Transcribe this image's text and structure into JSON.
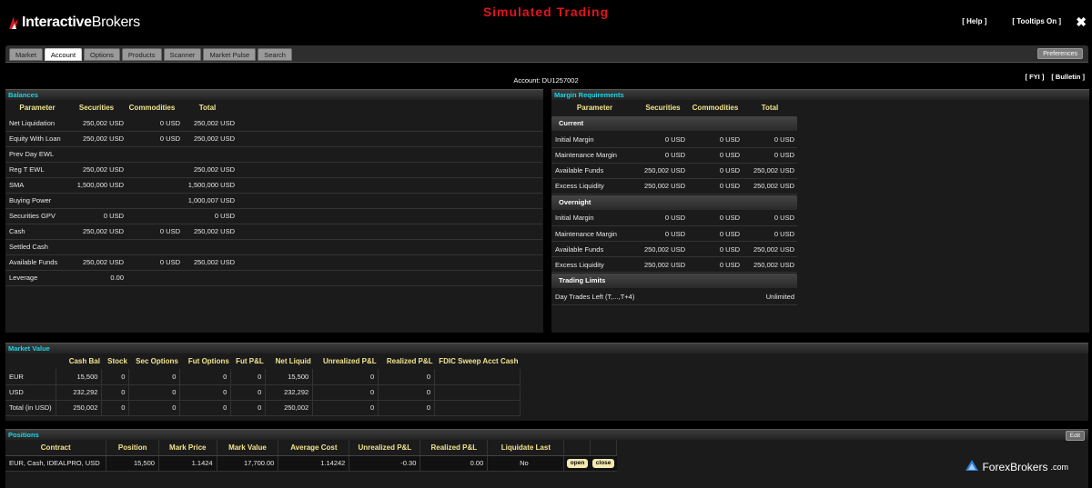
{
  "header": {
    "logo_bold": "Interactive",
    "logo_rest": "Brokers",
    "title": "Simulated Trading",
    "help": "[ Help ]",
    "tooltips": "[ Tooltips On ]",
    "close": "✖"
  },
  "tabs": [
    "Market",
    "Account",
    "Options",
    "Products",
    "Scanner",
    "Market Pulse",
    "Search"
  ],
  "preferences": "Preferences",
  "account_line": "Account: DU1257002",
  "fyi": "[ FYI ]",
  "bulletin": "[ Bulletin ]",
  "balances": {
    "title": "Balances",
    "columns": [
      "Parameter",
      "Securities",
      "Commodities",
      "Total"
    ],
    "rows": [
      [
        "Net Liquidation",
        "250,002 USD",
        "0 USD",
        "250,002 USD"
      ],
      [
        "Equity With Loan",
        "250,002 USD",
        "0 USD",
        "250,002 USD"
      ],
      [
        "Prev Day EWL",
        "",
        "",
        ""
      ],
      [
        "Reg T EWL",
        "250,002 USD",
        "",
        "250,002 USD"
      ],
      [
        "SMA",
        "1,500,000 USD",
        "",
        "1,500,000 USD"
      ],
      [
        "Buying Power",
        "",
        "",
        "1,000,007 USD"
      ],
      [
        "Securities GPV",
        "0 USD",
        "",
        "0 USD"
      ],
      [
        "Cash",
        "250,002 USD",
        "0 USD",
        "250,002 USD"
      ],
      [
        "Settled Cash",
        "",
        "",
        ""
      ],
      [
        "Available Funds",
        "250,002 USD",
        "0 USD",
        "250,002 USD"
      ],
      [
        "Leverage",
        "0.00",
        "",
        ""
      ]
    ]
  },
  "margin": {
    "title": "Margin Requirements",
    "columns": [
      "Parameter",
      "Securities",
      "Commodities",
      "Total"
    ],
    "sections": [
      {
        "name": "Current",
        "rows": [
          [
            "Initial Margin",
            "0 USD",
            "0 USD",
            "0 USD"
          ],
          [
            "Maintenance Margin",
            "0 USD",
            "0 USD",
            "0 USD"
          ],
          [
            "Available Funds",
            "250,002 USD",
            "0 USD",
            "250,002 USD"
          ],
          [
            "Excess Liquidity",
            "250,002 USD",
            "0 USD",
            "250,002 USD"
          ]
        ]
      },
      {
        "name": "Overnight",
        "rows": [
          [
            "Initial Margin",
            "0 USD",
            "0 USD",
            "0 USD"
          ],
          [
            "Maintenance Margin",
            "0 USD",
            "0 USD",
            "0 USD"
          ],
          [
            "Available Funds",
            "250,002 USD",
            "0 USD",
            "250,002 USD"
          ],
          [
            "Excess Liquidity",
            "250,002 USD",
            "0 USD",
            "250,002 USD"
          ]
        ]
      },
      {
        "name": "Trading Limits",
        "rows": [
          [
            "Day Trades Left (T,...,T+4)",
            "",
            "",
            "Unlimited"
          ]
        ]
      }
    ]
  },
  "market_value": {
    "title": "Market Value",
    "columns": [
      "",
      "Cash Bal",
      "Stock",
      "Sec Options",
      "Fut Options",
      "Fut P&L",
      "Net Liquid",
      "Unrealized P&L",
      "Realized P&L",
      "FDIC Sweep Acct Cash"
    ],
    "rows": [
      [
        "EUR",
        "15,500",
        "0",
        "0",
        "0",
        "0",
        "15,500",
        "0",
        "0",
        ""
      ],
      [
        "USD",
        "232,292",
        "0",
        "0",
        "0",
        "0",
        "232,292",
        "0",
        "0",
        ""
      ],
      [
        "Total (in USD)",
        "250,002",
        "0",
        "0",
        "0",
        "0",
        "250,002",
        "0",
        "0",
        ""
      ]
    ]
  },
  "positions": {
    "title": "Positions",
    "edit": "Edit",
    "columns": [
      "Contract",
      "Position",
      "Mark Price",
      "Mark Value",
      "Average Cost",
      "Unrealized P&L",
      "Realized P&L",
      "Liquidate Last",
      "",
      ""
    ],
    "rows": [
      [
        "EUR, Cash, IDEALPRO, USD",
        "15,500",
        "1.1424",
        "17,700.00",
        "1.14242",
        "-0.30",
        "0.00",
        "No"
      ]
    ],
    "open_label": "open",
    "close_label": "close"
  },
  "watermark": {
    "text": "ForexBrokers",
    "suffix": ".com"
  },
  "colors": {
    "title_red": "#e0141e",
    "panel_title_cyan": "#19d7e6",
    "column_header_yellow": "#f2e58e"
  }
}
